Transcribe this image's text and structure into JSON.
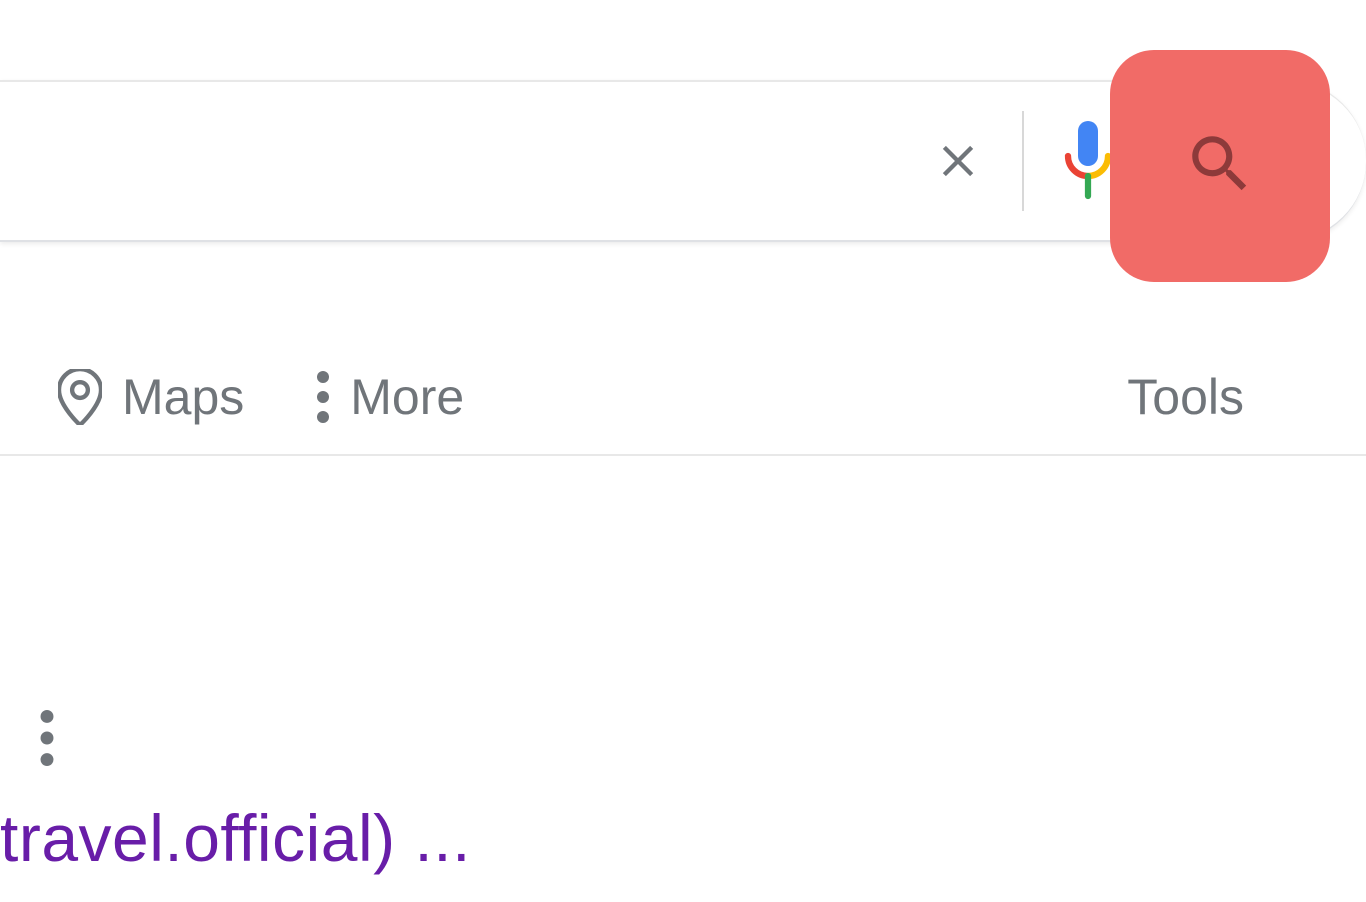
{
  "nav": {
    "maps": "Maps",
    "more": "More",
    "tools": "Tools"
  },
  "result": {
    "title_fragment": "travel.official) ..."
  },
  "icons": {
    "clear": "clear-icon",
    "mic": "mic-icon",
    "camera": "camera-icon",
    "search": "search-icon",
    "pin": "pin-icon",
    "dots": "more-dots-icon"
  }
}
